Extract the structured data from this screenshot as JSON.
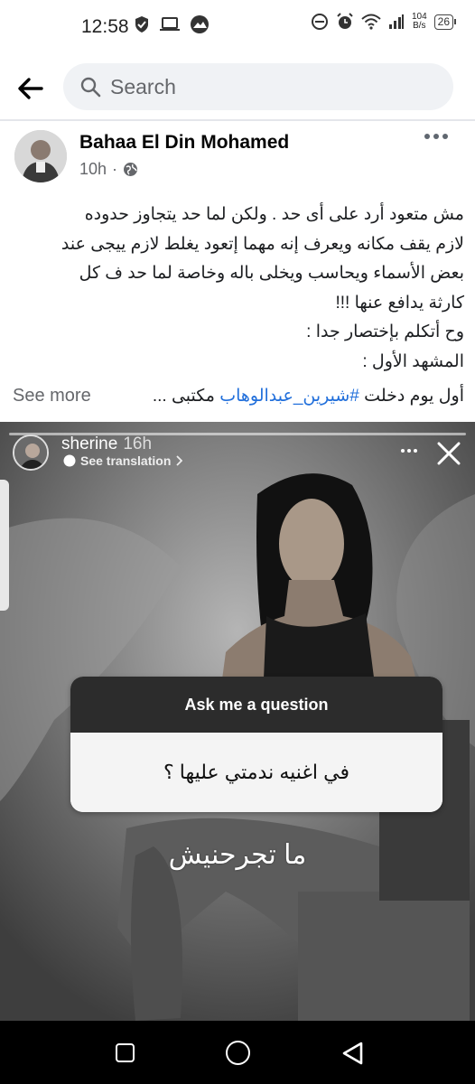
{
  "status_bar": {
    "time": "12:58",
    "network_speed_value": "104",
    "network_speed_unit": "B/s",
    "battery": "26"
  },
  "search": {
    "placeholder": "Search"
  },
  "post": {
    "author": "Bahaa El Din Mohamed",
    "time": "10h",
    "lines": [
      "مش متعود أرد على أى حد . ولكن لما حد يتجاوز حدوده",
      "لازم يقف مكانه ويعرف إنه مهما إتعود يغلط لازم ييجى عند",
      "بعض الأسماء ويحاسب ويخلى باله وخاصة لما حد ف كل",
      "كارثة يدافع عنها !!!",
      "وح أتكلم بإختصار جدا :",
      "المشهد الأول :"
    ],
    "last_line_start": "أول يوم دخلت",
    "hashtag": "#شيرين_عبدالوهاب",
    "last_line_end": "مكتبى ...",
    "see_more": "See more"
  },
  "story": {
    "username": "sherine",
    "time": "16h",
    "see_translation": "See translation",
    "question_title": "Ask me a question",
    "question_text": "في اغنيه ندمتي عليها ؟",
    "answer": "ما تجرحنيش"
  },
  "colors": {
    "link": "#216fdb",
    "secondary_text": "#65676b",
    "search_bg": "#f0f2f5"
  },
  "icons": [
    "back-arrow-icon",
    "search-icon",
    "globe-icon",
    "more-icon",
    "close-icon",
    "chevron-right-icon",
    "nav-recents-icon",
    "nav-home-icon",
    "nav-back-icon"
  ]
}
